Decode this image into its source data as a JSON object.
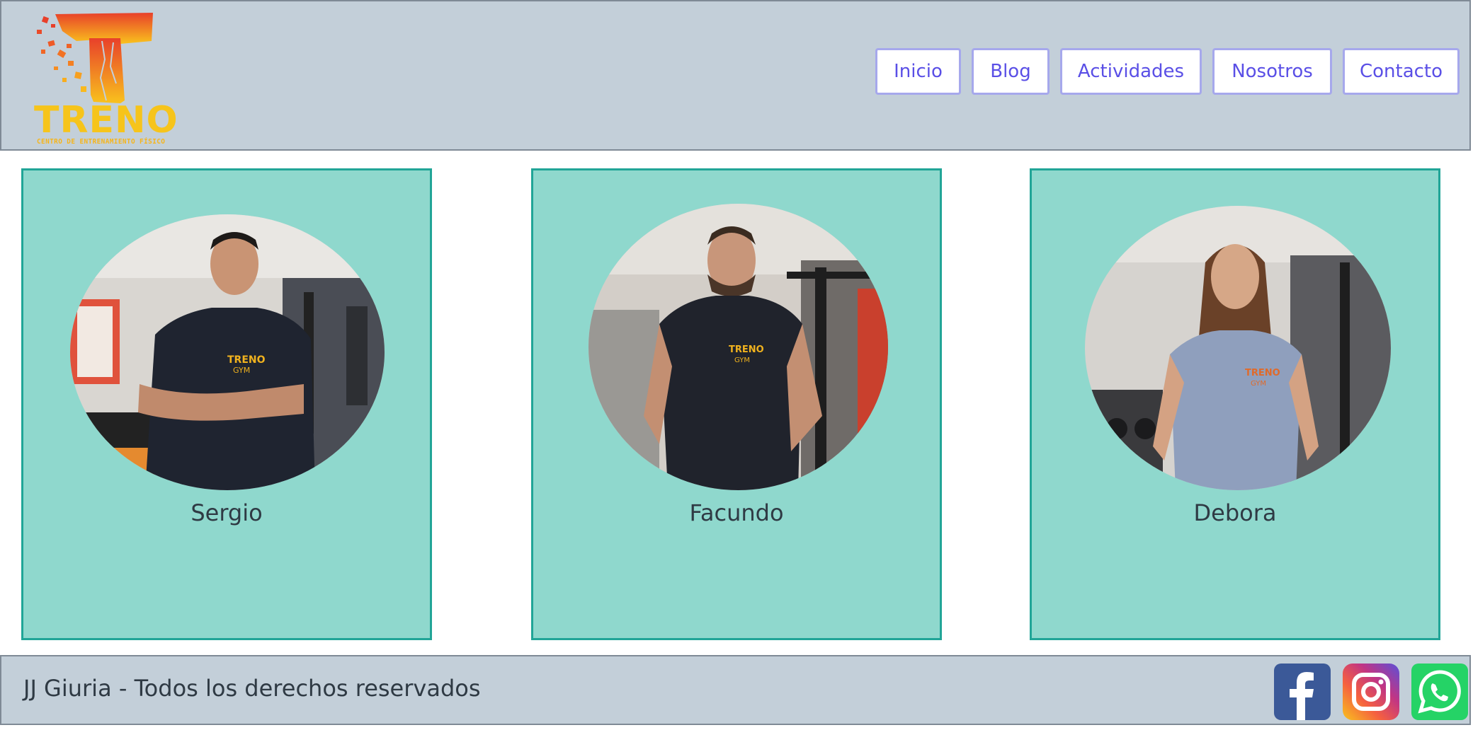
{
  "header": {
    "logo": {
      "name": "TRENO",
      "tagline": "CENTRO DE ENTRENAMIENTO FÍSICO",
      "colors": {
        "top": "#e8402a",
        "bottom": "#f9c21d"
      }
    },
    "nav": [
      {
        "label": "Inicio"
      },
      {
        "label": "Blog"
      },
      {
        "label": "Actividades"
      },
      {
        "label": "Nosotros"
      },
      {
        "label": "Contacto"
      }
    ]
  },
  "team": [
    {
      "name": "Sergio",
      "shirt_color": "#1f2430",
      "shirt_logo": "TRENO GYM"
    },
    {
      "name": "Facundo",
      "shirt_color": "#20232c",
      "shirt_logo": "TRENO GYM"
    },
    {
      "name": "Debora",
      "shirt_color": "#8f9fbd",
      "shirt_logo": "TRENO GYM"
    }
  ],
  "footer": {
    "text": "JJ Giuria - Todos los derechos reservados",
    "social": [
      {
        "icon": "facebook-icon",
        "color": "#3b5998"
      },
      {
        "icon": "instagram-icon",
        "color": "#c13584"
      },
      {
        "icon": "whatsapp-icon",
        "color": "#25d366"
      }
    ]
  },
  "colors": {
    "header_bg": "#c3cfd9",
    "card_bg": "#8fd8cd",
    "card_border": "#21a597",
    "nav_text": "#5a4fe6"
  }
}
